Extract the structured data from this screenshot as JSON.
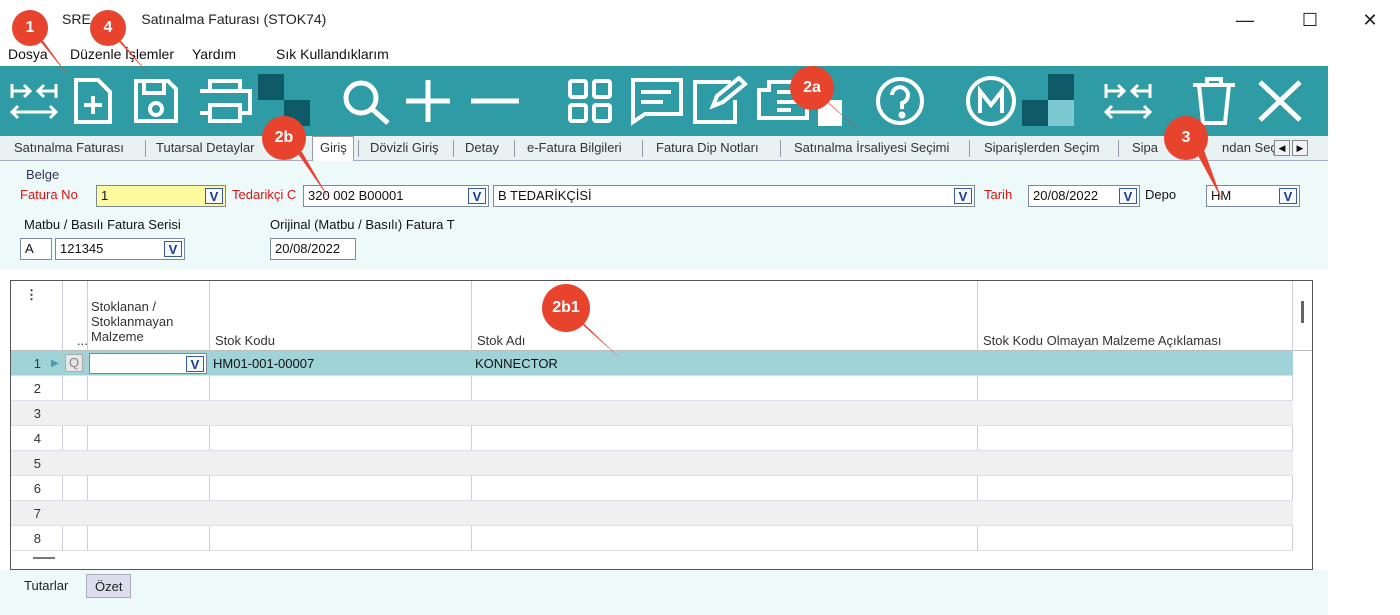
{
  "window": {
    "title_visible": "SRE",
    "title": "Satınalma Faturası (STOK74)",
    "minimize": "—",
    "maximize": "☐",
    "close": "✕"
  },
  "menu": {
    "items": [
      "Dosya",
      "Düzenle",
      "İşlemler",
      "Yardım",
      "Sık Kullandıklarım"
    ]
  },
  "toolbar": {
    "accent": "#2e9ba5",
    "icons": [
      "arrows-icon",
      "new-document-icon",
      "save-icon",
      "print-icon",
      "search-icon",
      "add-icon",
      "remove-icon",
      "grid-icon",
      "comment-icon",
      "edit-icon",
      "list-icon",
      "help-icon",
      "m-icon",
      "swap-arrows-icon",
      "delete-icon",
      "close-icon"
    ]
  },
  "tabs": {
    "items": [
      "Satınalma Faturası",
      "Tutarsal Detaylar",
      "Giriş",
      "Dövizli Giriş",
      "Detay",
      "e-Fatura Bilgileri",
      "Fatura Dip Notları",
      "Satınalma İrsaliyesi Seçimi",
      "Siparişlerden Seçim",
      "Sipa",
      "ndan Seç"
    ],
    "active": "Giriş"
  },
  "form": {
    "group_label": "Belge",
    "fatura_no_label": "Fatura No",
    "fatura_no_value": "1",
    "tedarikci_label": "Tedarikçi C",
    "tedarikci_code": "320 002 B00001",
    "tedarikci_name": "B TEDARİKÇİSİ",
    "tarih_label": "Tarih",
    "tarih_value": "20/08/2022",
    "depo_label": "Depo",
    "depo_value": "HM",
    "matbu_label": "Matbu / Basılı Fatura Serisi",
    "matbu_seri": "A",
    "matbu_no": "121345",
    "orijinal_label": "Orijinal (Matbu / Basılı) Fatura T",
    "orijinal_value": "20/08/2022",
    "dropdown_glyph": "V"
  },
  "grid": {
    "menu_glyph": "⋮",
    "ellipsis": "...",
    "headers": {
      "stoklanan": "Stoklanan / Stoklanmayan Malzeme",
      "stok_kodu": "Stok Kodu",
      "stok_adi": "Stok Adı",
      "aciklama": "Stok Kodu Olmayan Malzeme Açıklaması"
    },
    "rows": [
      {
        "num": "1",
        "stok_kodu": "HM01-001-00007",
        "stok_adi": "KONNECTOR"
      },
      {
        "num": "2",
        "stok_kodu": "",
        "stok_adi": ""
      },
      {
        "num": "3",
        "stok_kodu": "",
        "stok_adi": ""
      },
      {
        "num": "4",
        "stok_kodu": "",
        "stok_adi": ""
      },
      {
        "num": "5",
        "stok_kodu": "",
        "stok_adi": ""
      },
      {
        "num": "6",
        "stok_kodu": "",
        "stok_adi": ""
      },
      {
        "num": "7",
        "stok_kodu": "",
        "stok_adi": ""
      },
      {
        "num": "8",
        "stok_kodu": "",
        "stok_adi": ""
      }
    ],
    "q_glyph": "Q"
  },
  "bottom_tabs": [
    "Tutarlar",
    "Özet"
  ],
  "annotations": {
    "color": "#e8432d",
    "labels": [
      "1",
      "4",
      "2a",
      "2b",
      "3",
      "2b1"
    ]
  }
}
